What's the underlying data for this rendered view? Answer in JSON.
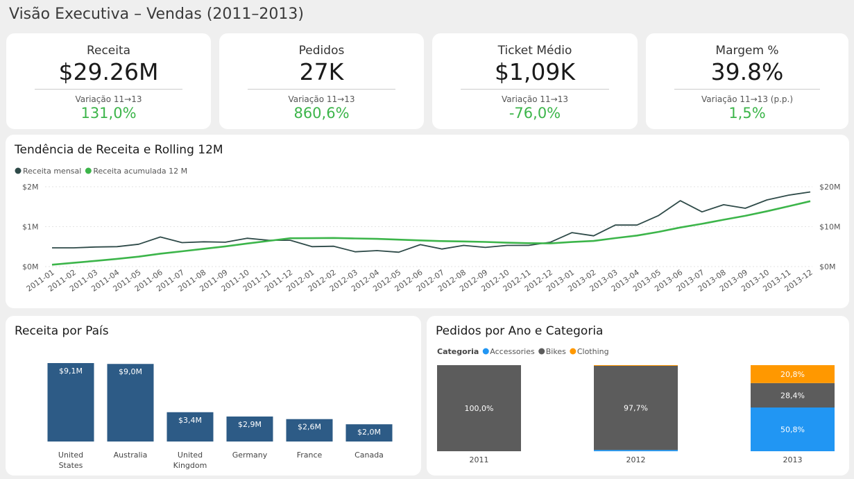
{
  "page_title": "Visão Executiva – Vendas (2011–2013)",
  "kpis": [
    {
      "title": "Receita",
      "value": "$29.26M",
      "var_label": "Variação 11→13",
      "var_value": "131,0%"
    },
    {
      "title": "Pedidos",
      "value": "27K",
      "var_label": "Variação 11→13",
      "var_value": "860,6%"
    },
    {
      "title": "Ticket Médio",
      "value": "$1,09K",
      "var_label": "Variação 11→13",
      "var_value": "-76,0%"
    },
    {
      "title": "Margem %",
      "value": "39.8%",
      "var_label": "Variação 11→13 (p.p.)",
      "var_value": "1,5%"
    }
  ],
  "colors": {
    "monthly": "#2e4a48",
    "rolling": "#3cb54a",
    "bar": "#2d5b86",
    "accessories": "#2196f3",
    "bikes": "#5c5c5c",
    "clothing": "#ff9800",
    "kpi_positive": "#3cb54a"
  },
  "trend_panel": {
    "title": "Tendência de Receita e Rolling 12M"
  },
  "country_panel": {
    "title": "Receita por País"
  },
  "orders_panel": {
    "title": "Pedidos por Ano e Categoria"
  },
  "chart_data": [
    {
      "type": "line",
      "x": [
        "2011-01",
        "2011-02",
        "2011-03",
        "2011-04",
        "2011-05",
        "2011-06",
        "2011-07",
        "2011-08",
        "2011-09",
        "2011-10",
        "2011-11",
        "2011-12",
        "2012-01",
        "2012-02",
        "2012-03",
        "2012-04",
        "2012-05",
        "2012-06",
        "2012-07",
        "2012-08",
        "2012-09",
        "2012-10",
        "2012-11",
        "2012-12",
        "2013-01",
        "2013-02",
        "2013-03",
        "2013-04",
        "2013-05",
        "2013-06",
        "2013-07",
        "2013-08",
        "2013-09",
        "2013-10",
        "2013-11",
        "2013-12"
      ],
      "series": [
        {
          "name": "Receita mensal",
          "axis": "left",
          "values": [
            0.47,
            0.47,
            0.49,
            0.5,
            0.56,
            0.74,
            0.6,
            0.62,
            0.61,
            0.71,
            0.66,
            0.66,
            0.5,
            0.51,
            0.37,
            0.4,
            0.36,
            0.55,
            0.44,
            0.53,
            0.48,
            0.53,
            0.53,
            0.61,
            0.85,
            0.77,
            1.04,
            1.04,
            1.28,
            1.65,
            1.37,
            1.55,
            1.46,
            1.67,
            1.79,
            1.87
          ]
        },
        {
          "name": "Receita acumulada 12 M",
          "axis": "right",
          "values": [
            0.47,
            0.94,
            1.43,
            1.93,
            2.49,
            3.23,
            3.83,
            4.45,
            5.06,
            5.77,
            6.43,
            7.09,
            7.12,
            7.16,
            7.04,
            6.94,
            6.74,
            6.55,
            6.39,
            6.3,
            6.17,
            5.99,
            5.86,
            5.81,
            6.16,
            6.42,
            7.13,
            7.77,
            8.69,
            9.79,
            10.72,
            11.74,
            12.72,
            13.86,
            15.12,
            16.38
          ]
        }
      ],
      "y_left": {
        "range": [
          0,
          2
        ],
        "ticks": [
          "$0M",
          "$1M",
          "$2M"
        ],
        "unit": "M"
      },
      "y_right": {
        "range": [
          0,
          20
        ],
        "ticks": [
          "$0M",
          "$10M",
          "$20M"
        ],
        "unit": "M"
      },
      "legend": "top-left",
      "grid": true
    },
    {
      "type": "bar",
      "categories": [
        "United States",
        "Australia",
        "United Kingdom",
        "Germany",
        "France",
        "Canada"
      ],
      "values": [
        9.1,
        9.0,
        3.4,
        2.9,
        2.6,
        2.0
      ],
      "labels": [
        "$9,1M",
        "$9,0M",
        "$3,4M",
        "$2,9M",
        "$2,6M",
        "$2,0M"
      ],
      "unit": "M"
    },
    {
      "type": "bar",
      "stacked": "percent",
      "legend_title": "Categoria",
      "legend": "top-left",
      "categories": [
        "2011",
        "2012",
        "2013"
      ],
      "series": [
        {
          "name": "Accessories",
          "values": [
            0.0,
            1.5,
            50.8
          ],
          "labels": [
            "",
            "",
            "50,8%"
          ]
        },
        {
          "name": "Bikes",
          "values": [
            100.0,
            97.7,
            28.4
          ],
          "labels": [
            "100,0%",
            "97,7%",
            "28,4%"
          ]
        },
        {
          "name": "Clothing",
          "values": [
            0.0,
            0.8,
            20.8
          ],
          "labels": [
            "",
            "",
            "20,8%"
          ]
        }
      ]
    }
  ]
}
